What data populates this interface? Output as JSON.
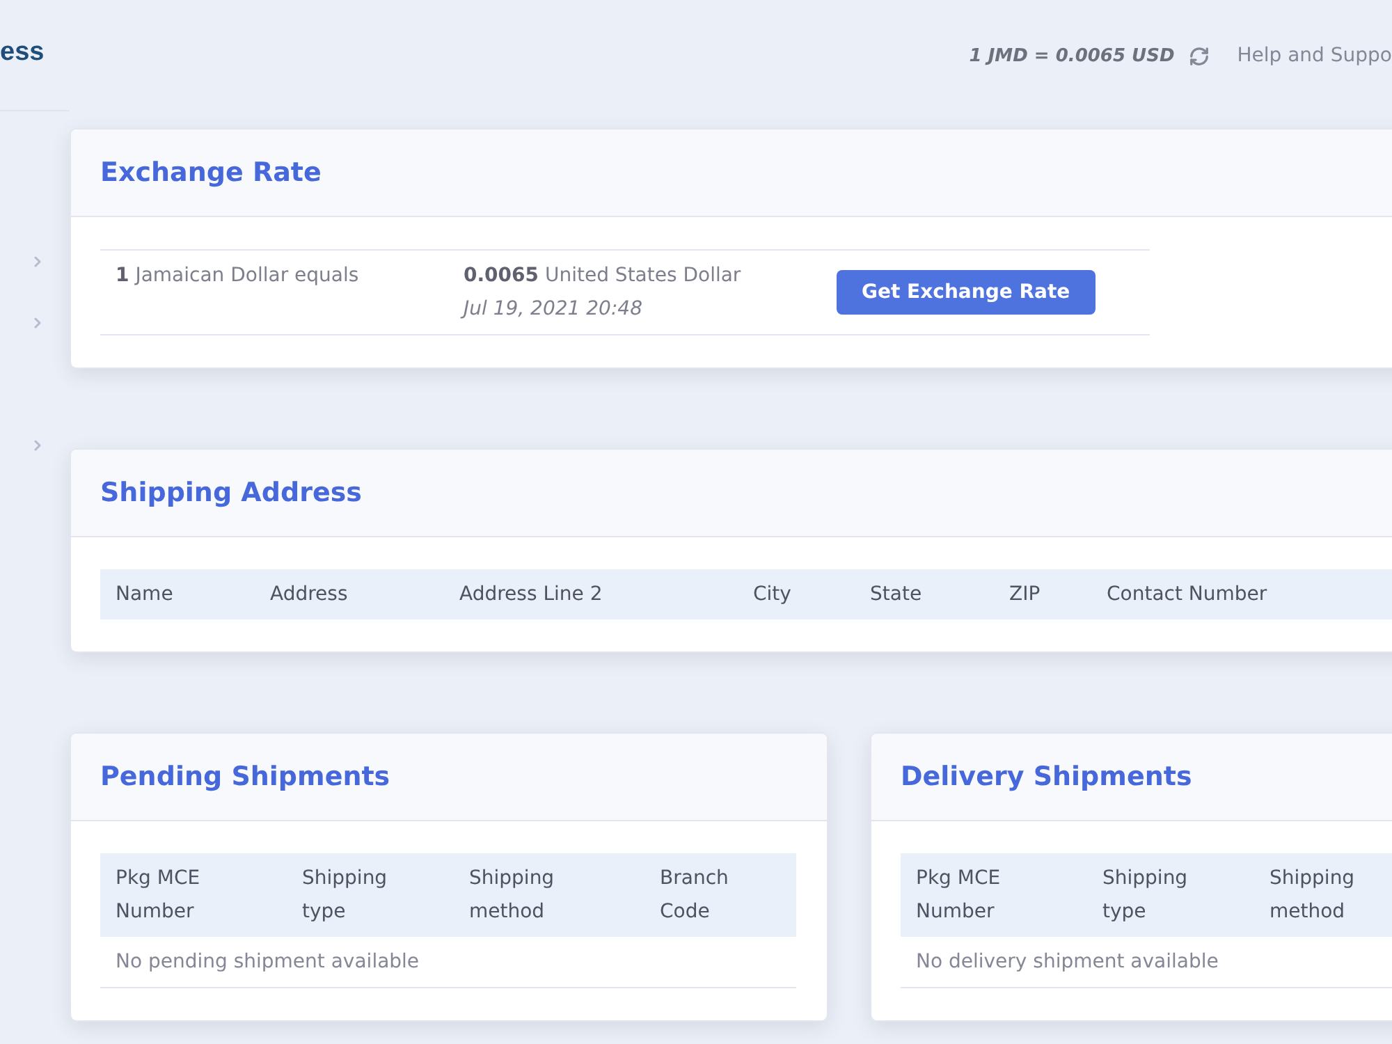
{
  "sidebar": {
    "logo": "ess",
    "groups": [
      {
        "items": [
          {
            "expanded": false
          },
          {
            "expanded": false
          }
        ]
      },
      {
        "items": [
          {
            "expanded": false
          }
        ]
      }
    ]
  },
  "topbar": {
    "rate": "1 JMD = 0.0065 USD",
    "help_link": "Help and Suppo"
  },
  "exchange_rate": {
    "title": "Exchange Rate",
    "from": "**1** Jamaican Dollar equals",
    "to": "**0.0065** United States Dollar",
    "updated": "Jul 19, 2021 20:48",
    "button": "Get Exchange Rate"
  },
  "shipping_address": {
    "title": "Shipping Address",
    "columns": [
      "Name",
      "Address",
      "Address Line 2",
      "City",
      "State",
      "ZIP",
      "Contact Number"
    ]
  },
  "pending_shipments": {
    "title": "Pending Shipments",
    "columns": [
      "Pkg MCE Number",
      "Shipping type",
      "Shipping method",
      "Branch Code"
    ],
    "empty_message": "No pending shipment available"
  },
  "delivery_shipments": {
    "title": "Delivery Shipments",
    "columns": [
      "Pkg MCE Number",
      "Shipping type",
      "Shipping method"
    ],
    "empty_message": "No delivery shipment available"
  }
}
